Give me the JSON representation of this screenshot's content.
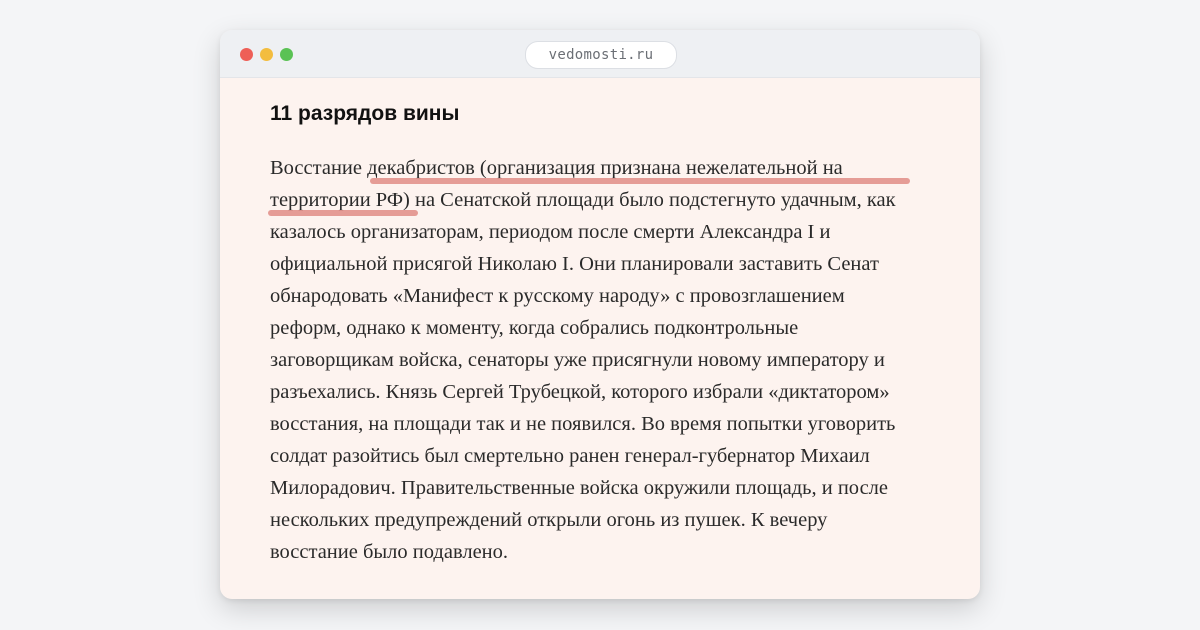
{
  "browser": {
    "url": "vedomosti.ru"
  },
  "article": {
    "heading": "11 разрядов вины",
    "lines": [
      "Восстание декабристов (организация признана нежелательной на",
      "территории РФ) на Сенатской площади было подстегнуто удачным, как",
      "казалось организаторам, периодом после смерти Александра I и",
      "официальной присягой Николаю I. Они планировали заставить Сенат",
      "обнародовать «Манифест к русскому народу» с провозглашением",
      "реформ, однако к моменту, когда собрались подконтрольные",
      "заговорщикам войска, сенаторы уже присягнули новому императору и",
      "разъехались. Князь Сергей Трубецкой, которого избрали «диктатором»",
      "восстания, на площади так и не появился. Во время попытки уговорить",
      "солдат разойтись был смертельно ранен генерал-губернатор Михаил",
      "Милорадович. Правительственные войска окружили площадь, и после",
      "нескольких предупреждений открыли огонь из пушек. К вечеру",
      "восстание было подавлено."
    ]
  },
  "colors": {
    "highlight_underline": "#e08c86",
    "page_background": "#fdf3ef"
  }
}
